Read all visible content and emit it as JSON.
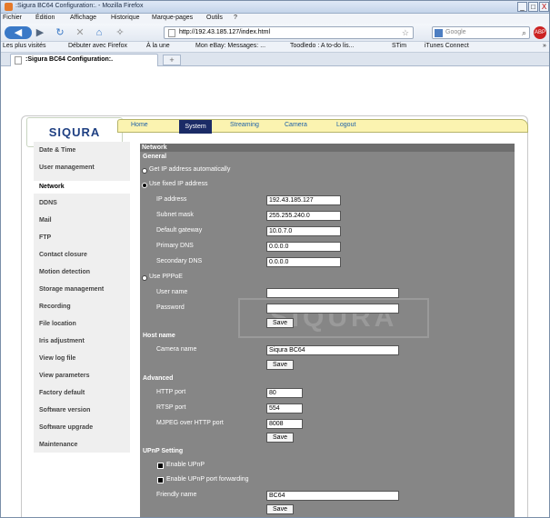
{
  "window": {
    "title": ":Sigura BC64 Configuration:. - Mozilla Firefox",
    "btn_min": "_",
    "btn_max": "□",
    "btn_close": "X"
  },
  "menubar": [
    "Fichier",
    "Édition",
    "Affichage",
    "Historique",
    "Marque-pages",
    "Outils",
    "?"
  ],
  "navbar": {
    "url": "http://192.43.185.127/index.html",
    "search_placeholder": "Google",
    "back_icon": "back-arrow",
    "forward_icon": "forward-arrow",
    "reload_icon": "reload",
    "stop_icon": "stop",
    "home_icon": "home"
  },
  "bookmarks": [
    "Les plus visités",
    "Débuter avec Firefox",
    "À la une",
    "Mon eBay: Messages: ...",
    "Toodledo : A to-do lis...",
    "STim",
    "iTunes Connect",
    "»"
  ],
  "tab": {
    "label": ":Sigura BC64 Configuration:.",
    "new_tab": "+"
  },
  "logo": "SIQURA",
  "nav": [
    "Home",
    "System",
    "Streaming",
    "Camera",
    "Logout"
  ],
  "sidebar": [
    "Date & Time",
    "User management",
    "Network",
    "DDNS",
    "Mail",
    "FTP",
    "Contact closure",
    "Motion detection",
    "Storage management",
    "Recording",
    "File location",
    "Iris adjustment",
    "View log file",
    "View parameters",
    "Factory default",
    "Software version",
    "Software upgrade",
    "Maintenance"
  ],
  "panel": {
    "title": "Network",
    "general": "General",
    "radio_auto": "Get IP address automatically",
    "radio_fixed": "Use fixed IP address",
    "ip_label": "IP address",
    "ip_value": "192.43.185.127",
    "mask_label": "Subnet mask",
    "mask_value": "255.255.240.0",
    "gw_label": "Default gateway",
    "gw_value": "10.0.7.0",
    "dns1_label": "Primary DNS",
    "dns1_value": "0.0.0.0",
    "dns2_label": "Secondary DNS",
    "dns2_value": "0.0.0.0",
    "radio_pppoe": "Use PPPoE",
    "user_label": "User name",
    "user_value": "",
    "pass_label": "Password",
    "pass_value": "",
    "save": "Save",
    "hostname": "Host name",
    "camera_label": "Camera name",
    "camera_value": "Siqura BC64",
    "advanced": "Advanced",
    "http_label": "HTTP port",
    "http_value": "80",
    "rtsp_label": "RTSP port",
    "rtsp_value": "554",
    "mjpeg_label": "MJPEG over HTTP port",
    "mjpeg_value": "8008",
    "upnp": "UPnP Setting",
    "upnp_enable": "Enable UPnP",
    "upnp_forward": "Enable UPnP port forwarding",
    "friendly_label": "Friendly name",
    "friendly_value": "BC64",
    "watermark": "SIQURA"
  }
}
